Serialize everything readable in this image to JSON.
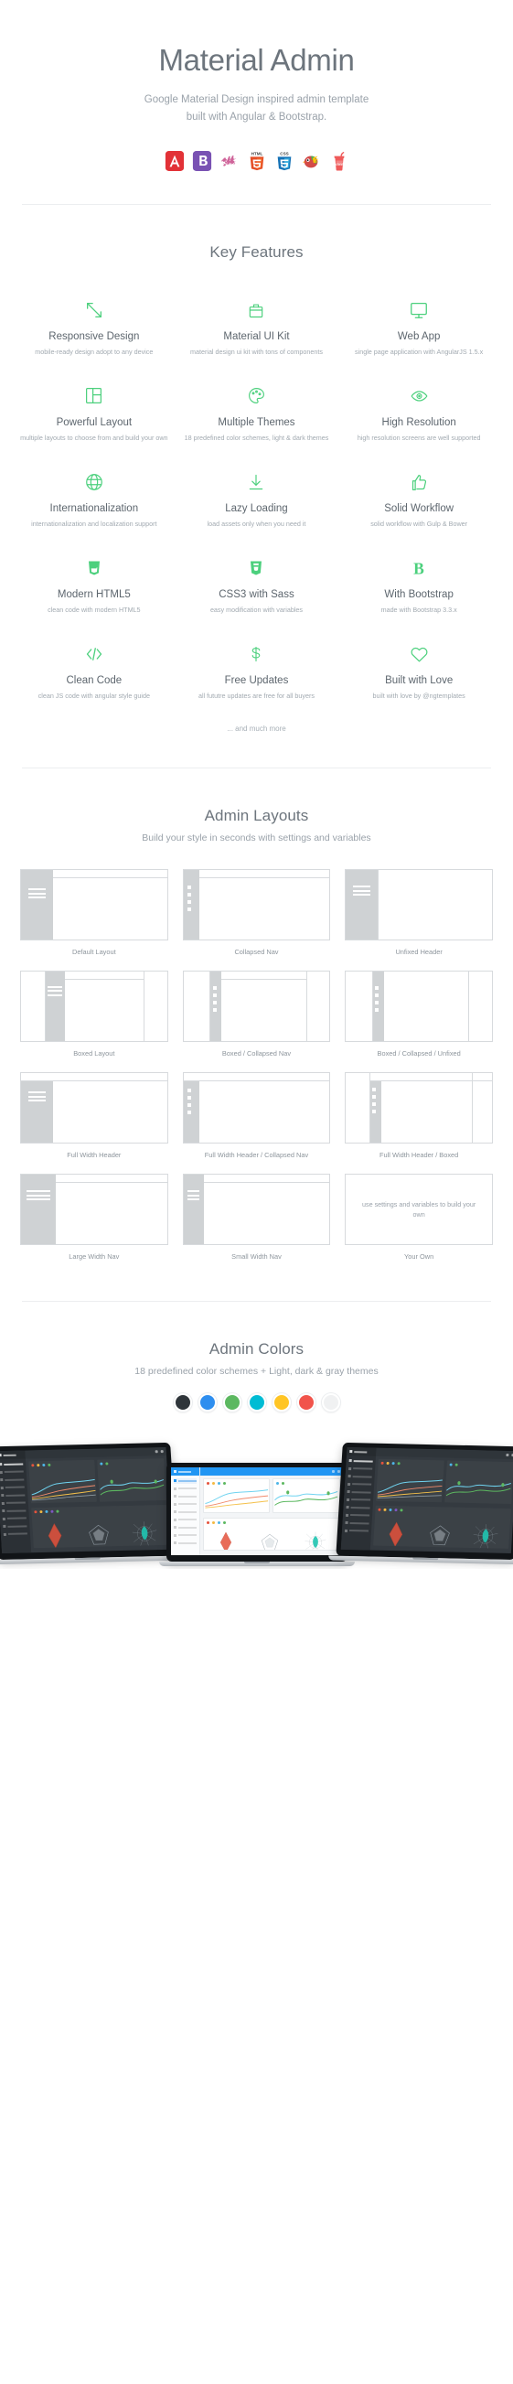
{
  "hero": {
    "title": "Material Admin",
    "subtitle_line1": "Google Material Design inspired admin template",
    "subtitle_line2": "built with Angular & Bootstrap.",
    "tech_icons": [
      {
        "name": "angularjs-icon",
        "label": "AngularJS"
      },
      {
        "name": "bootstrap-icon",
        "label": "Bootstrap"
      },
      {
        "name": "sass-icon",
        "label": "Sass"
      },
      {
        "name": "html5-icon",
        "label": "HTML5"
      },
      {
        "name": "css3-icon",
        "label": "CSS3"
      },
      {
        "name": "gulp-icon",
        "label": "Gulp"
      },
      {
        "name": "bower-icon",
        "label": "Bower"
      }
    ]
  },
  "features_section": {
    "title": "Key Features",
    "footer_note": "... and much more",
    "items": [
      {
        "icon": "resize-arrows-icon",
        "title": "Responsive Design",
        "desc": "mobile-ready design adopt to any device"
      },
      {
        "icon": "toolbox-icon",
        "title": "Material UI Kit",
        "desc": "material design ui kit with tons of components"
      },
      {
        "icon": "monitor-icon",
        "title": "Web App",
        "desc": "single page application with AngularJS 1.5.x"
      },
      {
        "icon": "layout-grid-icon",
        "title": "Powerful Layout",
        "desc": "multiple layouts to choose from and build your own"
      },
      {
        "icon": "palette-icon",
        "title": "Multiple Themes",
        "desc": "18 predefined color schemes, light & dark themes"
      },
      {
        "icon": "eye-icon",
        "title": "High Resolution",
        "desc": "high resolution screens are well supported"
      },
      {
        "icon": "globe-icon",
        "title": "Internationalization",
        "desc": "internationalization and localization support"
      },
      {
        "icon": "download-arrow-icon",
        "title": "Lazy Loading",
        "desc": "load assets only when you need it"
      },
      {
        "icon": "thumbs-up-icon",
        "title": "Solid Workflow",
        "desc": "solid workflow with Gulp & Bower"
      },
      {
        "icon": "html5-shield-icon",
        "title": "Modern HTML5",
        "desc": "clean code with modern HTML5"
      },
      {
        "icon": "css3-shield-icon",
        "title": "CSS3 with Sass",
        "desc": "easy modification with variables"
      },
      {
        "icon": "bootstrap-b-icon",
        "title": "With Bootstrap",
        "desc": "made with Bootstrap 3.3.x"
      },
      {
        "icon": "code-brackets-icon",
        "title": "Clean Code",
        "desc": "clean JS code with angular style guide"
      },
      {
        "icon": "dollar-icon",
        "title": "Free Updates",
        "desc": "all fututre updates are free for all buyers"
      },
      {
        "icon": "heart-icon",
        "title": "Built with Love",
        "desc": "built with love by @ngtemplates"
      }
    ]
  },
  "layouts_section": {
    "title": "Admin Layouts",
    "subtitle": "Build your style in seconds with settings and variables",
    "items": [
      {
        "label": "Default Layout",
        "variant": "default",
        "nav": "burger",
        "boxed": false,
        "header": "inset"
      },
      {
        "label": "Collapsed Nav",
        "variant": "collapsed",
        "nav": "dots",
        "boxed": false,
        "header": "inset"
      },
      {
        "label": "Unfixed Header",
        "variant": "unfixed",
        "nav": "burger",
        "boxed": false,
        "header": "none"
      },
      {
        "label": "Boxed Layout",
        "variant": "boxed",
        "nav": "burger",
        "boxed": true,
        "header": "inset"
      },
      {
        "label": "Boxed / Collapsed Nav",
        "variant": "boxed-collapsed",
        "nav": "dots",
        "boxed": true,
        "header": "inset"
      },
      {
        "label": "Boxed / Collapsed / Unfixed",
        "variant": "boxed-collapsed-unfixed",
        "nav": "dots",
        "boxed": true,
        "header": "none"
      },
      {
        "label": "Full Width Header",
        "variant": "fullwidth",
        "nav": "burger",
        "boxed": false,
        "header": "full"
      },
      {
        "label": "Full Width Header / Collapsed Nav",
        "variant": "fullwidth-collapsed",
        "nav": "dots",
        "boxed": false,
        "header": "full"
      },
      {
        "label": "Full Width Header / Boxed",
        "variant": "fullwidth-boxed",
        "nav": "dots",
        "boxed": true,
        "header": "full"
      },
      {
        "label": "Large Width Nav",
        "variant": "large-nav",
        "nav": "burger-wide",
        "boxed": false,
        "header": "inset"
      },
      {
        "label": "Small Width Nav",
        "variant": "small-nav",
        "nav": "burger-small",
        "boxed": false,
        "header": "inset"
      },
      {
        "label": "Your Own",
        "variant": "custom",
        "placeholder": "use settings and variables to build your own"
      }
    ]
  },
  "colors_section": {
    "title": "Admin Colors",
    "subtitle": "18 predefined color schemes + Light, dark & gray themes",
    "swatches": [
      {
        "name": "dark-theme-swatch",
        "hex": "#2f353a"
      },
      {
        "name": "blue-theme-swatch",
        "hex": "#2e8eef"
      },
      {
        "name": "green-theme-swatch",
        "hex": "#5cb860"
      },
      {
        "name": "cyan-theme-swatch",
        "hex": "#00bcd4"
      },
      {
        "name": "amber-theme-swatch",
        "hex": "#ffc525"
      },
      {
        "name": "red-theme-swatch",
        "hex": "#f1544b"
      },
      {
        "name": "light-theme-swatch",
        "hex": "#f0f1f2"
      }
    ]
  },
  "devices_section": {
    "items": [
      {
        "name": "laptop-dark-left",
        "theme": "dark"
      },
      {
        "name": "laptop-light-center",
        "theme": "light"
      },
      {
        "name": "laptop-dark-right",
        "theme": "dark"
      }
    ]
  },
  "accent_color": "#4cd07d"
}
